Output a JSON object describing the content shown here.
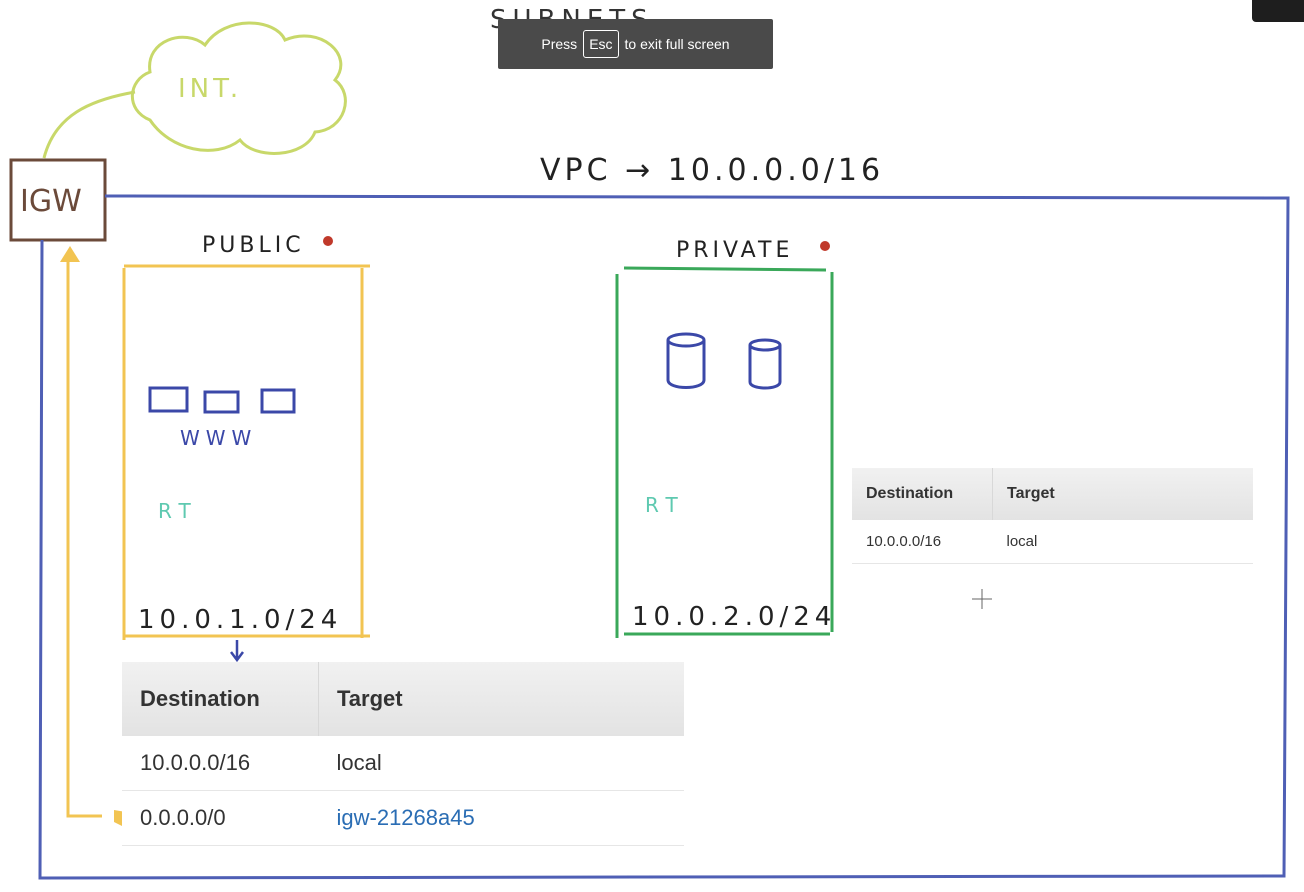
{
  "heading": "SUBNETS",
  "fullscreen_toast": {
    "prefix": "Press",
    "key": "Esc",
    "suffix": "to exit full screen"
  },
  "internet_label": "INT.",
  "igw_label": "IGW",
  "vpc_label": "VPC → 10.0.0.0/16",
  "public_subnet": {
    "label": "PUBLIC",
    "cidr": "10.0.1.0/24",
    "rt_label": "RT",
    "servers_label": "WWW"
  },
  "private_subnet": {
    "label": "PRIVATE",
    "cidr": "10.0.2.0/24",
    "rt_label": "RT"
  },
  "private_route_table": {
    "headers": [
      "Destination",
      "Target"
    ],
    "rows": [
      {
        "destination": "10.0.0.0/16",
        "target": "local"
      }
    ]
  },
  "public_route_table": {
    "headers": [
      "Destination",
      "Target"
    ],
    "rows": [
      {
        "destination": "10.0.0.0/16",
        "target": "local"
      },
      {
        "destination": "0.0.0.0/0",
        "target": "igw-21268a45"
      }
    ]
  },
  "colors": {
    "vpc": "#4f5fb5",
    "public": "#f2c452",
    "private": "#3aa85a",
    "internet": "#c8d86a",
    "igw": "#6b4a3a",
    "rt": "#5ec9b0",
    "servers": "#3b48a8",
    "link": "#2a6db4",
    "dot": "#c0392b"
  }
}
